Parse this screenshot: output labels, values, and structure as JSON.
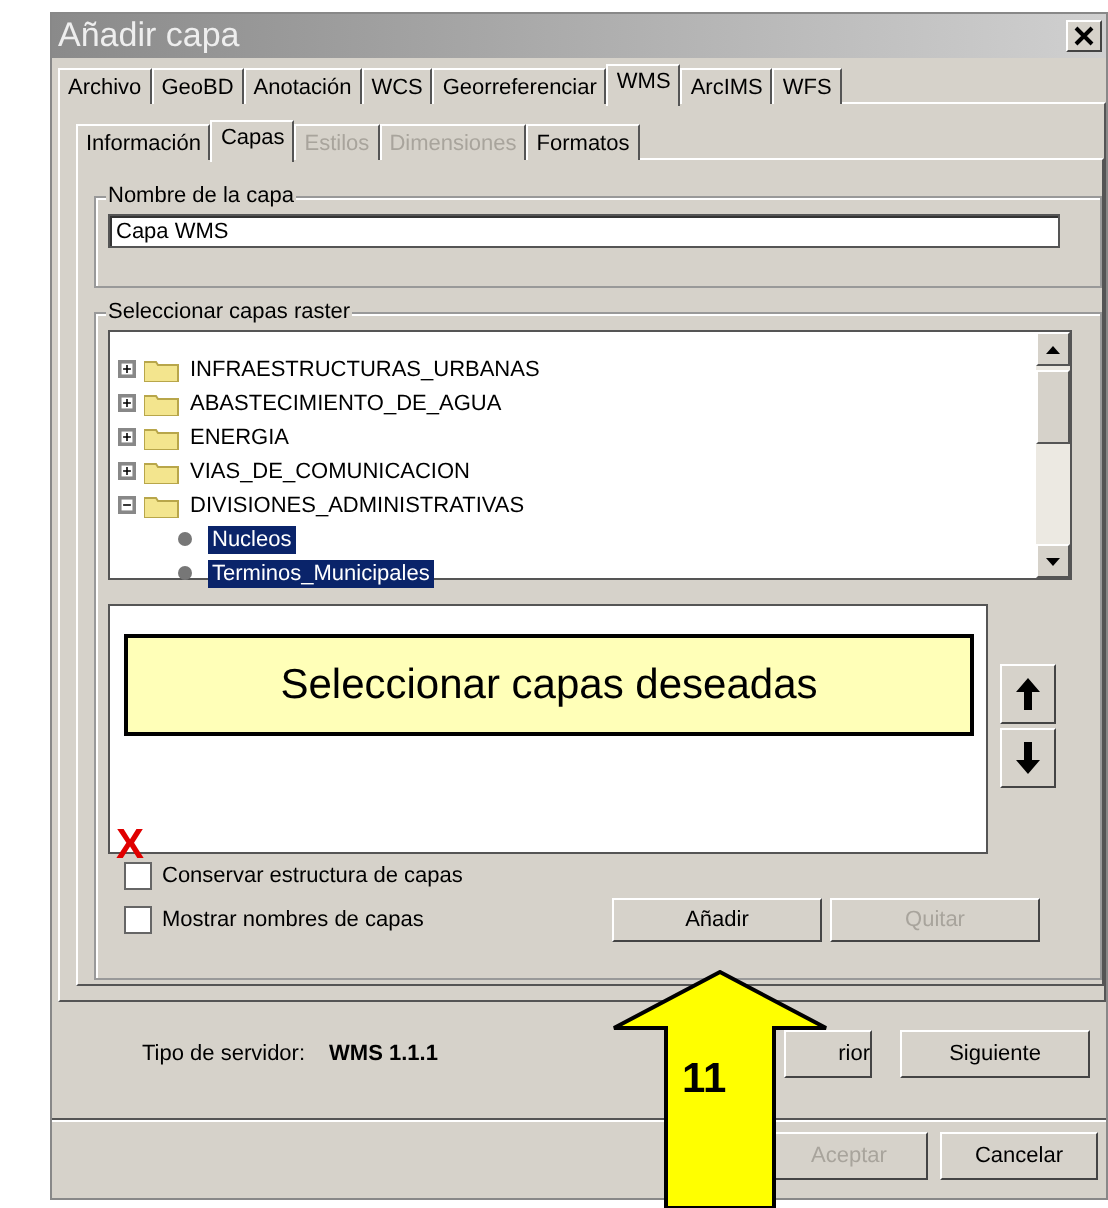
{
  "window": {
    "title": "Añadir capa"
  },
  "tabs": [
    {
      "label": "Archivo",
      "selected": false
    },
    {
      "label": "GeoBD",
      "selected": false
    },
    {
      "label": "Anotación",
      "selected": false
    },
    {
      "label": "WCS",
      "selected": false
    },
    {
      "label": "Georreferenciar",
      "selected": false
    },
    {
      "label": "WMS",
      "selected": true
    },
    {
      "label": "ArcIMS",
      "selected": false
    },
    {
      "label": "WFS",
      "selected": false
    }
  ],
  "subtabs": [
    {
      "label": "Información",
      "selected": false,
      "disabled": false
    },
    {
      "label": "Capas",
      "selected": true,
      "disabled": false
    },
    {
      "label": "Estilos",
      "selected": false,
      "disabled": true
    },
    {
      "label": "Dimensiones",
      "selected": false,
      "disabled": true
    },
    {
      "label": "Formatos",
      "selected": false,
      "disabled": false
    }
  ],
  "layer_name": {
    "label": "Nombre de la capa",
    "value": "Capa WMS"
  },
  "raster": {
    "label": "Seleccionar capas raster",
    "tree": [
      {
        "label": "INFRAESTRUCTURAS_URBANAS",
        "expanded": false,
        "selected": false
      },
      {
        "label": "ABASTECIMIENTO_DE_AGUA",
        "expanded": false,
        "selected": false
      },
      {
        "label": "ENERGIA",
        "expanded": false,
        "selected": false
      },
      {
        "label": "VIAS_DE_COMUNICACION",
        "expanded": false,
        "selected": false
      },
      {
        "label": "DIVISIONES_ADMINISTRATIVAS",
        "expanded": true,
        "selected": false,
        "children": [
          {
            "label": "Nucleos",
            "selected": true
          },
          {
            "label": "Terminos_Municipales",
            "selected": true
          }
        ]
      }
    ],
    "options": [
      {
        "label": "Conservar estructura de capas",
        "checked": false
      },
      {
        "label": "Mostrar nombres de capas",
        "checked": false
      }
    ],
    "buttons": [
      {
        "label": "Añadir",
        "disabled": false
      },
      {
        "label": "Quitar",
        "disabled": true
      }
    ]
  },
  "server": {
    "label": "Tipo de servidor:",
    "value": "WMS 1.1.1"
  },
  "nav_buttons": [
    {
      "label": "rior",
      "disabled": false
    },
    {
      "label": "Siguiente",
      "disabled": false
    }
  ],
  "footer_buttons": [
    {
      "label": "Aceptar",
      "disabled": true
    },
    {
      "label": "Cancelar",
      "disabled": false
    }
  ],
  "annotations": [
    {
      "kind": "callout",
      "text": "Seleccionar capas deseadas"
    },
    {
      "kind": "mark",
      "text": "X"
    },
    {
      "kind": "arrow",
      "text": "11"
    }
  ]
}
